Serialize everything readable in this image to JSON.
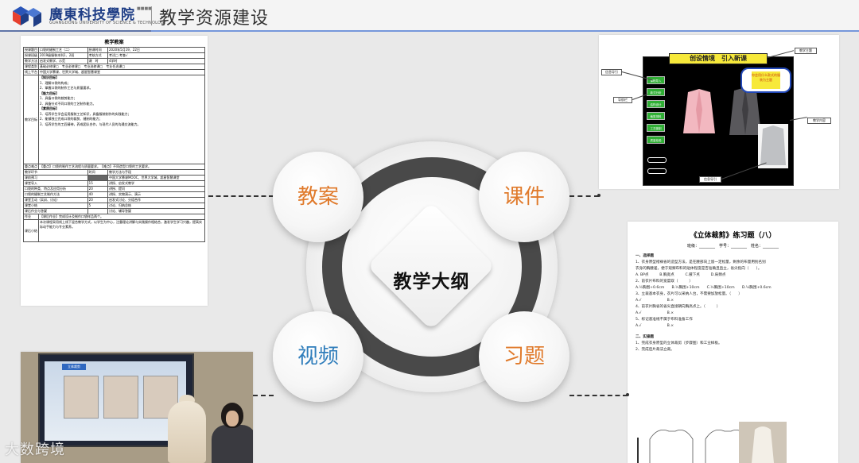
{
  "header": {
    "school_name": "廣東科技學院",
    "school_name_en": "GUANGDONG UNIVERSITY OF SCIENCE & TECHNOLOGY",
    "school_tag": "■■■■",
    "page_title": "教学资源建设",
    "brand_color": "#1f3e86"
  },
  "diagram": {
    "center": "教学大纲",
    "nodes": [
      {
        "label": "教案",
        "color": "#e07a2b"
      },
      {
        "label": "课件",
        "color": "#e07a2b"
      },
      {
        "label": "视频",
        "color": "#2f7dbb"
      },
      {
        "label": "习题",
        "color": "#e07a2b"
      }
    ]
  },
  "lesson_plan": {
    "title": "教学教案",
    "row1": [
      "授课题目",
      "口袋的缝制工艺（二）",
      "授课时间",
      "2020年5月19、22日"
    ],
    "row2": [
      "授课班级",
      "2019级服装本科1、2班",
      "考核方式",
      "考试□ 考查√"
    ],
    "row3": [
      "教学方法",
      "启发式教学、示范",
      "课　时",
      "4学时"
    ],
    "row4": [
      "课程类别",
      "基础必修课□　专业必修课□　专业选修课□　专业任选课□"
    ],
    "row5": [
      "线上平台",
      "中国大学慕课、世界大学城、超星智慧课堂"
    ],
    "objectives_label": "教学目标",
    "objectives": [
      "【知识目标】",
      "1．理解口袋的构成；",
      "2．掌握口袋的制作工艺与质量要求。",
      "【能力目标】",
      "1．具备口袋的裁剪能力；",
      "2．具备针对不同口袋的工艺制作能力。",
      "【素质目标】",
      "1．培养学生学会运用服装工艺知识，具备服装制作的实践能力；",
      "2．能够独立完成口袋的裁剪、缝制的能力；",
      "3．培养学生的工匠精神，养成团队合作，与现代人员的沟通交流能力。"
    ],
    "key_label": "重点难点",
    "key_text": "【重点】口袋的制作工艺流程与质量要求。【难点】不同造型口袋的工艺要求。",
    "process_header": [
      "教学环节",
      "时间",
      "教学方法与手段"
    ],
    "process_rows": [
      [
        "课前预习",
        "",
        "中国大学慕课MOOC、世界大学城、超星智慧课堂"
      ],
      [
        "课堂导入",
        "15",
        "讲授、启发式教学"
      ],
      [
        "口袋的种类、特点及应用分析",
        "20",
        "讲授、提问"
      ],
      [
        "口袋的缝制工艺制作方法",
        "40",
        "讲授、实物演示、演示"
      ],
      [
        "课堂互动（实训、讨论）",
        "20",
        "启发式讨论、分组合作"
      ],
      [
        "课堂小结",
        "5",
        "讨论、归纳总结"
      ],
      [
        "课后作业与答疑",
        "",
        "讨论、辅导答疑"
      ]
    ],
    "homework_label": "作业",
    "homework_text": "【课后作业】完成设计及制作口袋样品两个。",
    "summary_label": "课后小结",
    "summary_text": "本次课程采用线上线下混合教学方式，以学生为中心，注重理论讲解与实践操作相结合，激发学生学习兴趣，提高实际动手能力与专业素养。"
  },
  "courseware": {
    "banner": "创设情境　引入新课",
    "bubble_text": "你会用什么款式的服装为主题",
    "buttons": [
      "课程导入",
      "款式分析",
      "结构设计",
      "裁剪排料",
      "工艺缝制",
      "质量检验"
    ],
    "callouts": [
      "信息导引",
      "教学主题",
      "信息导引",
      "导航栏",
      "教学内容"
    ]
  },
  "exercise": {
    "title": "《立体裁剪》练习题（八）",
    "meta": "班级：________　学号：________　姓名：________",
    "sections": [
      {
        "heading": "一、选择题",
        "lines": [
          "1、衣身原型褶裥省的造型方法，是在腰部向上留一定松量，剩余的布量用别名别",
          "衣身的胸腰差，便于观察布料的贴体程度是否准确且直立，省尖指向（　　）。",
          "A. BP点　　　B.胸宽点　　　C.腋下点　　　D.肩颈点",
          "2、前衣片布料的宽度取（　　　）",
          "A.½胸围+0.6cm　　B.½胸围+10cm　　C.½胸围+10cm　　D.½胸围+0.6cm",
          "3、立裁基本衣身，衣片可以采纳人台，不需要加放松量。（　　）",
          "A.√　　　　　　　B.×",
          "4、前衣片胸省的省尖直接朝向胸高点上。（　　　）",
          "A.√　　　　　　　B.×",
          "5、标记基准线不属于布料准备工作",
          "A.√　　　　　　　B.×"
        ]
      },
      {
        "heading": "二、实操题",
        "lines": [
          "1、完成衣身原型的立体裁剪（步骤图）和工业样板。",
          "2、完成后片裁法立裁。"
        ]
      }
    ]
  },
  "video": {
    "screen_tab": "立体裁剪"
  },
  "watermark": "大数跨境"
}
